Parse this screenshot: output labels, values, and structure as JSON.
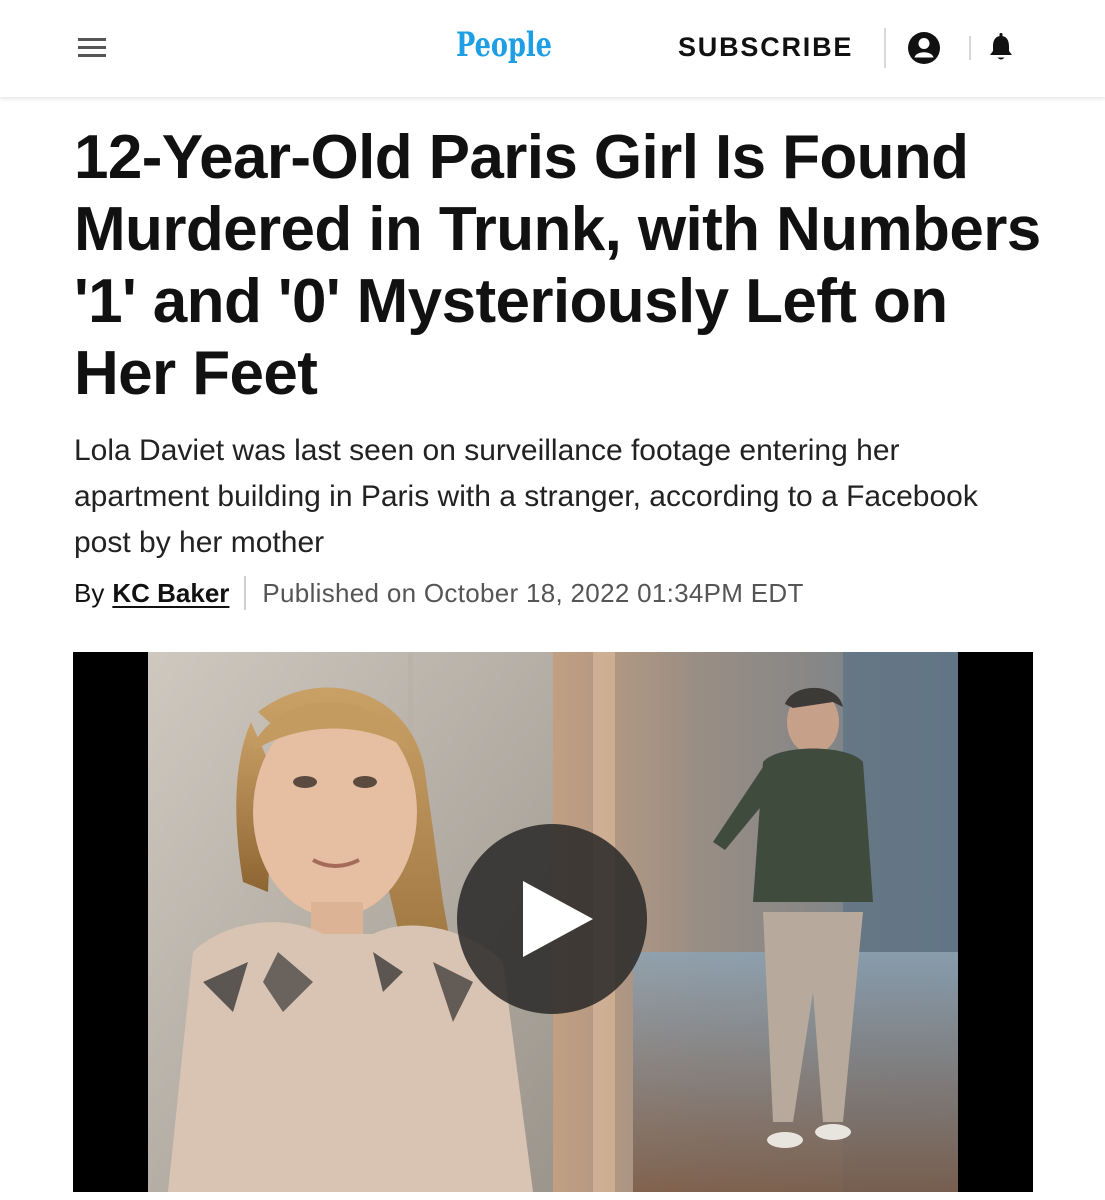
{
  "header": {
    "logo_text": "People",
    "subscribe_label": "SUBSCRIBE",
    "icons": [
      "menu-icon",
      "account-icon",
      "bell-icon"
    ],
    "logo_color": "#1d9ee5"
  },
  "article": {
    "headline": "12-Year-Old Paris Girl Is Found Murdered in Trunk, with Numbers '1' and '0' Mysteriously Left on Her Feet",
    "dek": "Lola Daviet was last seen on surveillance footage entering her apartment building in Paris with a stranger, according to a Facebook post by her mother",
    "byline_prefix": "By",
    "author": "KC Baker",
    "published": "Published on October 18, 2022 01:34PM EDT"
  },
  "video": {
    "play_icon": "play-icon"
  }
}
